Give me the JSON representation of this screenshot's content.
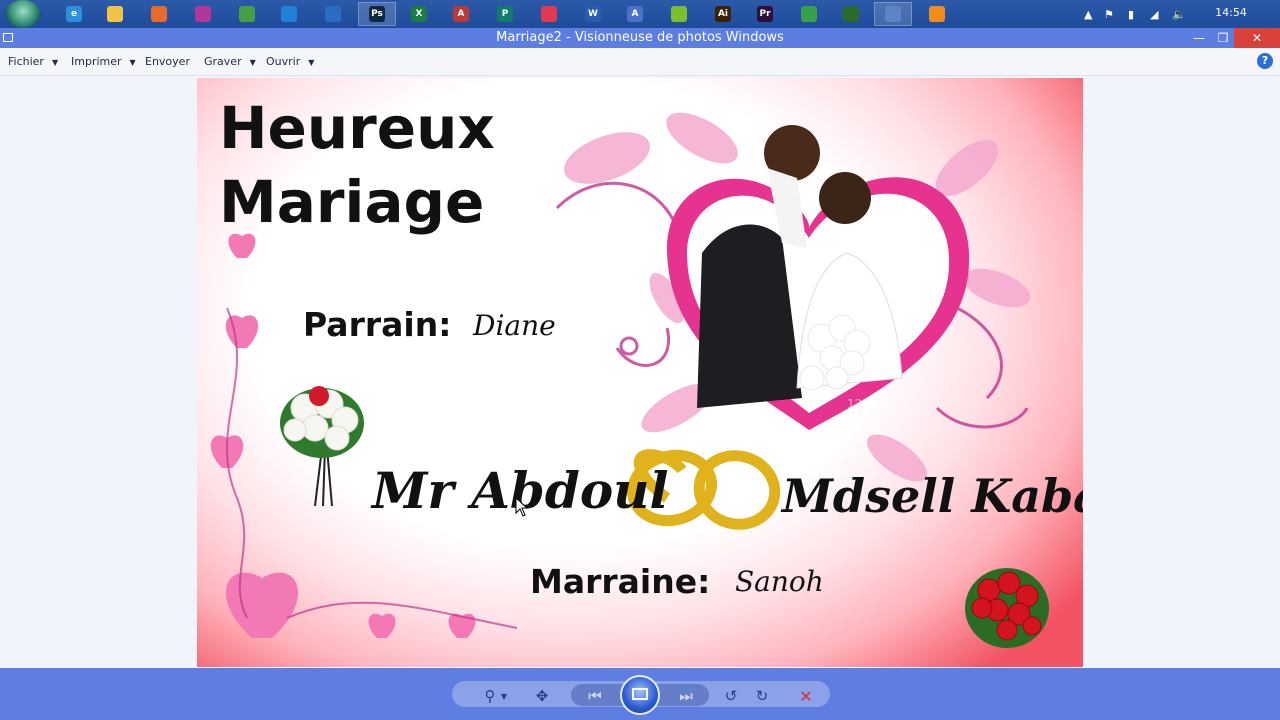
{
  "taskbar": {
    "apps": [
      {
        "name": "internet-explorer",
        "letter": "e",
        "color": "#2a8fdc"
      },
      {
        "name": "file-explorer",
        "letter": "",
        "color": "#f2c443"
      },
      {
        "name": "firefox",
        "letter": "",
        "color": "#e66b2c"
      },
      {
        "name": "app-purple",
        "letter": "",
        "color": "#b2379a"
      },
      {
        "name": "app-green",
        "letter": "",
        "color": "#43a047"
      },
      {
        "name": "vscode",
        "letter": "",
        "color": "#1f82d6"
      },
      {
        "name": "app-monitor",
        "letter": "",
        "color": "#2a6dc0"
      },
      {
        "name": "photoshop",
        "letter": "Ps",
        "color": "#0f2a40"
      },
      {
        "name": "excel",
        "letter": "X",
        "color": "#1e7b45"
      },
      {
        "name": "access",
        "letter": "A",
        "color": "#b63a3a"
      },
      {
        "name": "publisher",
        "letter": "P",
        "color": "#107c6a"
      },
      {
        "name": "app-red",
        "letter": "",
        "color": "#e03a52"
      },
      {
        "name": "word",
        "letter": "W",
        "color": "#2b5cb0"
      },
      {
        "name": "app-a",
        "letter": "A",
        "color": "#4d70c8"
      },
      {
        "name": "app-lime",
        "letter": "",
        "color": "#7bbf2e"
      },
      {
        "name": "illustrator",
        "letter": "Ai",
        "color": "#3b2206"
      },
      {
        "name": "premiere",
        "letter": "Pr",
        "color": "#2c0f3a"
      },
      {
        "name": "app-green2",
        "letter": "",
        "color": "#37a04a"
      },
      {
        "name": "app-globe",
        "letter": "",
        "color": "#2c6a2c"
      },
      {
        "name": "photo-viewer",
        "letter": "",
        "color": "#5d84c9"
      },
      {
        "name": "vlc",
        "letter": "",
        "color": "#f28c18"
      }
    ],
    "clock": "14:54"
  },
  "window": {
    "title": "Marriage2 - Visionneuse de photos Windows",
    "minimize": "—",
    "restore": "❐",
    "close": "✕"
  },
  "menu": {
    "items": [
      {
        "label": "Fichier"
      },
      {
        "label": "Imprimer"
      },
      {
        "label": "Envoyer"
      },
      {
        "label": "Graver"
      },
      {
        "label": "Ouvrir"
      }
    ],
    "help": "?"
  },
  "photo": {
    "headline1": "Heureux",
    "headline2": "Mariage",
    "godfather_label": "Parrain:",
    "godfather_name": "Diane",
    "groom": "Mr Abdoul",
    "bride": "Mdsell Kaba",
    "godmother_label": "Marraine:",
    "godmother_name": "Sanoh",
    "watermark": "123RF"
  },
  "colors": {
    "titlebar": "#5c7de1",
    "toolbar": "#5f7ee2",
    "heart": "#e6338f",
    "gold": "#e0b31c"
  }
}
